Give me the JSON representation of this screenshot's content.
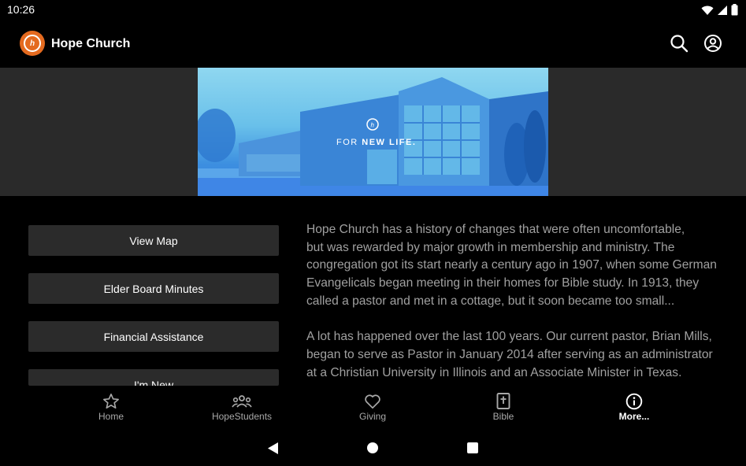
{
  "status_bar": {
    "time": "10:26"
  },
  "app_bar": {
    "title": "Hope Church"
  },
  "hero": {
    "tagline_prefix": "FOR ",
    "tagline_bold": "NEW LIFE."
  },
  "buttons": [
    {
      "label": "View Map"
    },
    {
      "label": "Elder Board Minutes"
    },
    {
      "label": "Financial Assistance"
    },
    {
      "label": "I'm New"
    }
  ],
  "description": {
    "paragraphs": [
      "Hope Church has a history of changes that were often uncomfortable,\nbut was rewarded by major growth in membership and ministry. The\ncongregation got its start nearly a century ago in 1907, when some German\nEvangelicals began meeting in their homes for Bible study. In 1913, they\ncalled a pastor and met in a cottage, but it soon became too small...",
      "A lot has happened over the last 100 years.  Our current pastor, Brian Mills,\nbegan to serve as Pastor in January 2014 after serving as an administrator\nat a Christian University in Illinois and an Associate Minister in Texas."
    ]
  },
  "bottom_nav": {
    "items": [
      {
        "label": "Home",
        "icon": "star-icon"
      },
      {
        "label": "HopeStudents",
        "icon": "group-icon"
      },
      {
        "label": "Giving",
        "icon": "heart-icon"
      },
      {
        "label": "Bible",
        "icon": "bible-icon"
      },
      {
        "label": "More...",
        "icon": "info-icon",
        "active": true
      }
    ]
  },
  "colors": {
    "brand": "#e46a1f",
    "background": "#000000",
    "button_bg": "#2b2b2b",
    "body_text": "#a0a0a0"
  }
}
